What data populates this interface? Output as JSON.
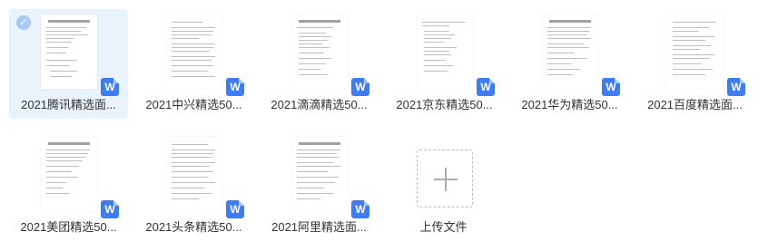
{
  "files": [
    {
      "name": "2021腾讯精选面...",
      "selected": true,
      "type_icon": "W"
    },
    {
      "name": "2021中兴精选50...",
      "selected": false,
      "type_icon": "W"
    },
    {
      "name": "2021滴滴精选50...",
      "selected": false,
      "type_icon": "W"
    },
    {
      "name": "2021京东精选50...",
      "selected": false,
      "type_icon": "W"
    },
    {
      "name": "2021华为精选50...",
      "selected": false,
      "type_icon": "W"
    },
    {
      "name": "2021百度精选面...",
      "selected": false,
      "type_icon": "W"
    },
    {
      "name": "2021美团精选50...",
      "selected": false,
      "type_icon": "W"
    },
    {
      "name": "2021头条精选50...",
      "selected": false,
      "type_icon": "W"
    },
    {
      "name": "2021阿里精选面...",
      "selected": false,
      "type_icon": "W"
    }
  ],
  "upload": {
    "label": "上传文件"
  },
  "colors": {
    "accent": "#3f7cf2",
    "selected_bg": "#eaf2fb"
  }
}
